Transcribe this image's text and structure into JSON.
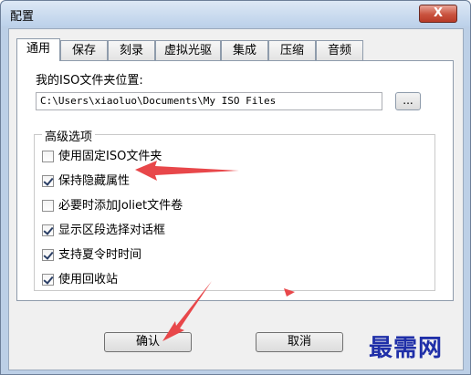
{
  "window": {
    "title": "配置",
    "close_label": "X"
  },
  "tabs": [
    {
      "label": "通用",
      "active": true
    },
    {
      "label": "保存"
    },
    {
      "label": "刻录"
    },
    {
      "label": "虚拟光驱"
    },
    {
      "label": "集成"
    },
    {
      "label": "压缩"
    },
    {
      "label": "音频"
    }
  ],
  "general": {
    "iso_folder_label": "我的ISO文件夹位置:",
    "iso_folder_path": "C:\\Users\\xiaoluo\\Documents\\My ISO Files",
    "browse_label": "...",
    "advanced_title": "高级选项",
    "options": [
      {
        "label": "使用固定ISO文件夹",
        "checked": false
      },
      {
        "label": "保持隐藏属性",
        "checked": true
      },
      {
        "label": "必要时添加Joliet文件卷",
        "checked": false
      },
      {
        "label": "显示区段选择对话框",
        "checked": true
      },
      {
        "label": "支持夏令时时间",
        "checked": true
      },
      {
        "label": "使用回收站",
        "checked": true
      }
    ]
  },
  "buttons": {
    "ok": "确认",
    "cancel": "取消"
  },
  "watermark": "最需网",
  "colors": {
    "annotation_arrow": "#e8474a",
    "watermark": "#1f2fa8"
  }
}
